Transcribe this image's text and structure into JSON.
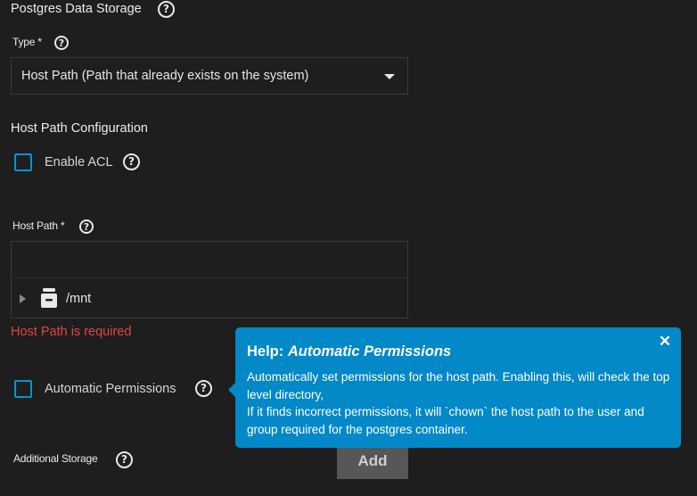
{
  "storage": {
    "section_title": "Postgres Data Storage",
    "type_label": "Type",
    "type_required": "*",
    "type_value": "Host Path (Path that already exists on the system)"
  },
  "host_path_config": {
    "title": "Host Path Configuration",
    "enable_acl_label": "Enable ACL",
    "enable_acl_checked": false,
    "host_path_label": "Host Path",
    "host_path_required": "*",
    "host_path_value": "",
    "tree": {
      "root_label": "/mnt",
      "root_icon": "dataset-icon"
    },
    "error": "Host Path is required",
    "automatic_permissions_label": "Automatic Permissions",
    "automatic_permissions_checked": false
  },
  "additional_storage": {
    "label": "Additional Storage",
    "add_label": "Add"
  },
  "tooltip": {
    "title_prefix": "Help: ",
    "title_topic": "Automatic Permissions",
    "close_glyph": "✕",
    "body_line1": "Automatically set permissions for the host path. Enabling this, will check the top level directory,",
    "body_line2": "If it finds incorrect permissions, it will `chown` the host path to the user and group required for the postgres container."
  },
  "colors": {
    "background": "#1e1e1e",
    "accent": "#0095d5",
    "tooltip_bg": "#0388c8",
    "error": "#e0483e",
    "button_bg": "#575757"
  }
}
